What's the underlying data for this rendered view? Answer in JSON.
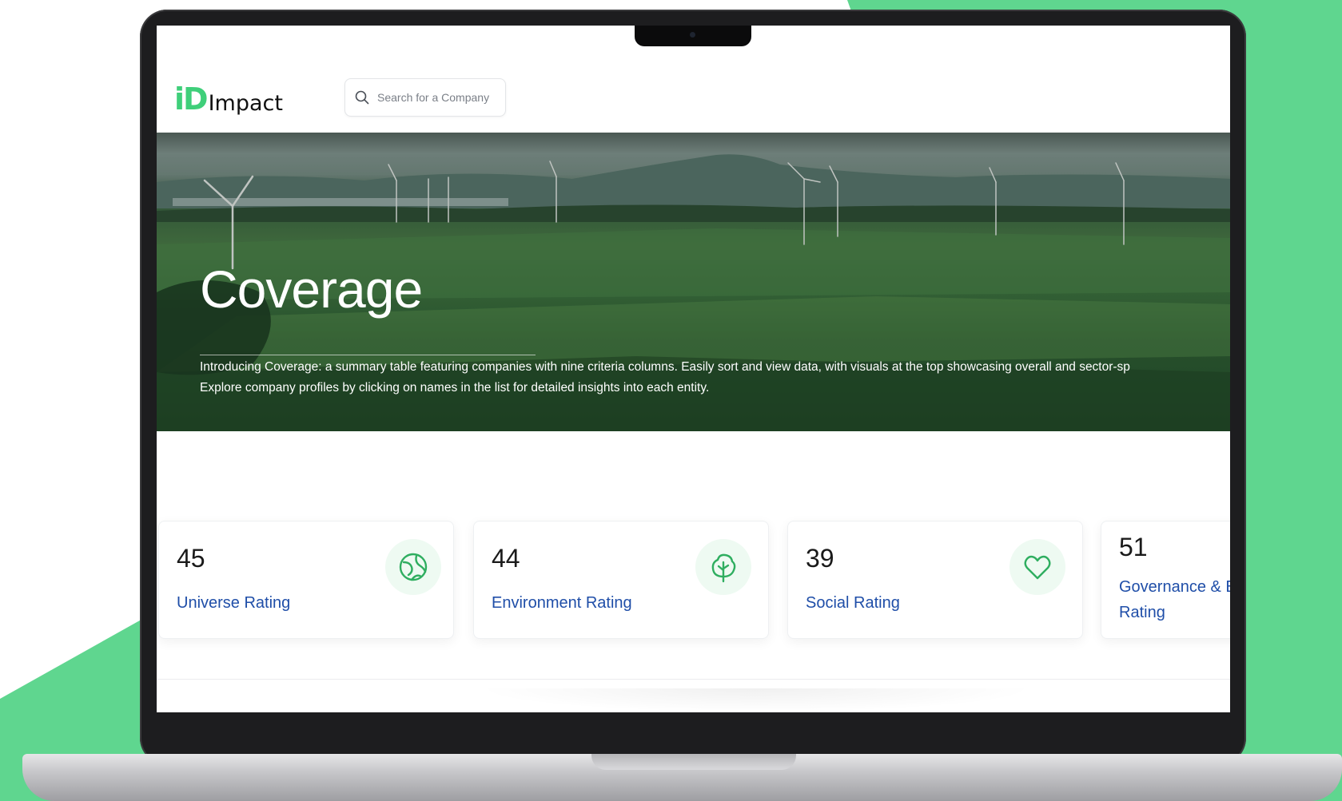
{
  "colors": {
    "accent_green": "#5fd68f",
    "brand_green": "#3fcf7a",
    "link_blue": "#1f4ea8",
    "icon_green": "#2fae60"
  },
  "header": {
    "logo_mark": "iD",
    "logo_text": "Impact",
    "search": {
      "placeholder": "Search for a Company",
      "icon": "search-icon"
    }
  },
  "hero": {
    "title": "Coverage",
    "description_line1": "Introducing Coverage: a summary table featuring companies with nine criteria columns. Easily sort and view data, with visuals at the top showcasing overall and sector-sp",
    "description_line2": "Explore company profiles by clicking on names in the list for detailed insights into each entity."
  },
  "cards": [
    {
      "value": "45",
      "label": "Universe Rating",
      "icon": "globe-icon"
    },
    {
      "value": "44",
      "label": "Environment Rating",
      "icon": "tree-icon"
    },
    {
      "value": "39",
      "label": "Social Rating",
      "icon": "heart-icon"
    },
    {
      "value": "51",
      "label_line1": "Governance & E",
      "label_line2": "Rating"
    }
  ]
}
